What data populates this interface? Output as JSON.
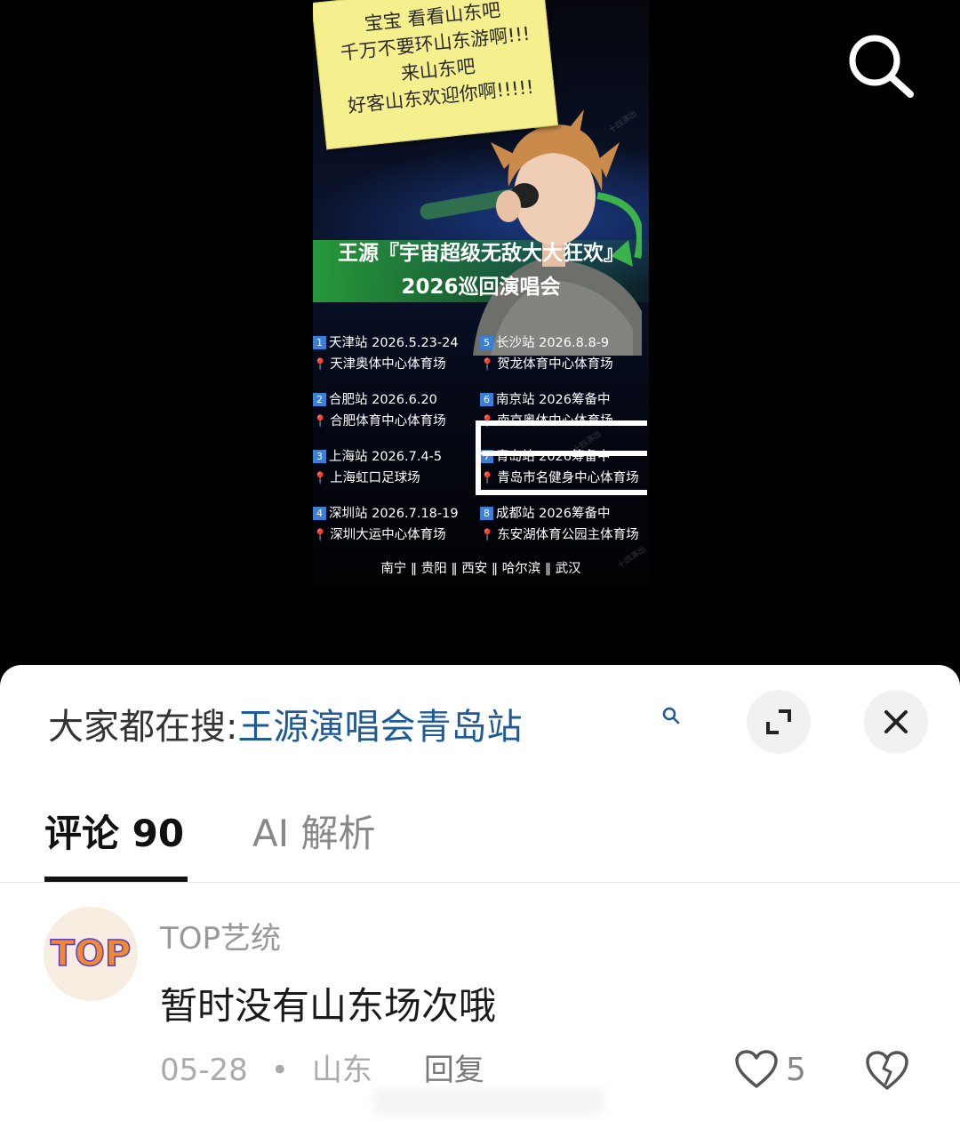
{
  "poster": {
    "sticky_note": [
      "宝宝 看看山东吧",
      "千万不要环山东游啊!!!",
      "来山东吧",
      "好客山东欢迎你啊!!!!!"
    ],
    "title": "王源『宇宙超级无敌大大狂欢』",
    "subtitle": "2026巡回演唱会",
    "stops": [
      {
        "num": "1",
        "station": "天津站 2026.5.23-24",
        "venue": "天津奥体中心体育场"
      },
      {
        "num": "2",
        "station": "合肥站 2026.6.20",
        "venue": "合肥体育中心体育场"
      },
      {
        "num": "3",
        "station": "上海站 2026.7.4-5",
        "venue": "上海虹口足球场"
      },
      {
        "num": "4",
        "station": "深圳站 2026.7.18-19",
        "venue": "深圳大运中心体育场"
      },
      {
        "num": "5",
        "station": "长沙站 2026.8.8-9",
        "venue": "贺龙体育中心体育场"
      },
      {
        "num": "6",
        "station": "南京站 2026筹备中",
        "venue": "南京奥体中心体育场"
      },
      {
        "num": "7",
        "station": "青岛站 2026筹备中",
        "venue": "青岛市名健身中心体育场"
      },
      {
        "num": "8",
        "station": "成都站 2026筹备中",
        "venue": "东安湖体育公园主体育场"
      }
    ],
    "more_cities": "南宁 ‖ 贵阳 ‖ 西安 ‖ 哈尔滨 ‖ 武汉",
    "watermark": "十四演出"
  },
  "sheet": {
    "suggest_prefix": "大家都在搜:",
    "suggest_term": "王源演唱会青岛站",
    "tabs": {
      "comments": "评论 90",
      "ai": "AI 解析"
    }
  },
  "comment": {
    "username": "TOP艺统",
    "avatar_text": "TOP",
    "text": "暂时没有山东场次哦",
    "date": "05-28",
    "separator": "•",
    "location": "山东",
    "reply": "回复",
    "likes": "5"
  },
  "colors": {
    "link_blue": "#1e5a96",
    "sheet_bg": "#ffffff",
    "poster_green": "#28a03c"
  }
}
